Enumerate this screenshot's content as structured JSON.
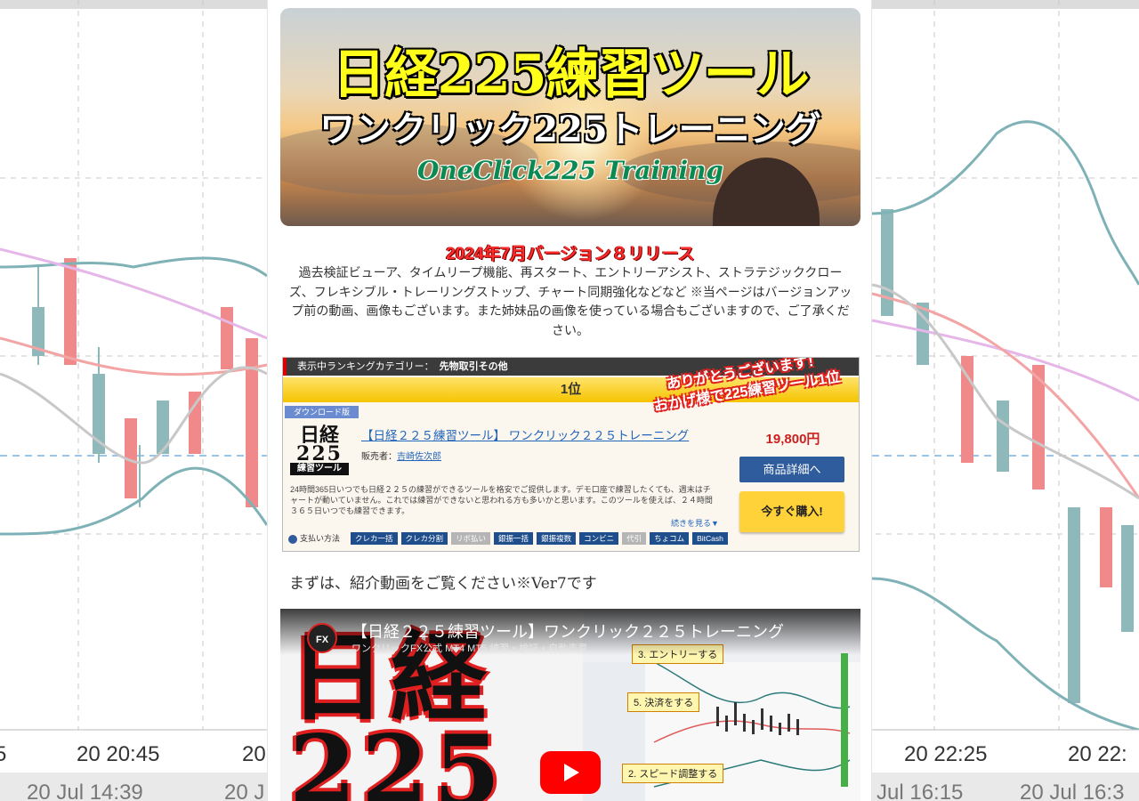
{
  "background": {
    "left_time_top": "20 20:45",
    "left_time_top_partial": "5",
    "left_time_top_partial_right": "20",
    "left_time_bottom": "20 Jul 14:39",
    "left_time_bottom_partial": "20 J",
    "right_time_top": "20 22:25",
    "right_time_top_2": "20 22:",
    "right_time_bottom": "Jul 16:15",
    "right_time_bottom_2": "20 Jul 16:3"
  },
  "hero": {
    "title": "日経225練習ツール",
    "subtitle": "ワンクリック225トレーニング",
    "english": "OneClick225 Training"
  },
  "release": {
    "title": "2024年7月バージョン８リリース",
    "text": "過去検証ビューア、タイムリープ機能、再スタート、エントリーアシスト、ストラテジッククローズ、フレキシブル・トレーリングストップ、チャート同期強化などなど ※当ページはバージョンアップ前の動画、画像もございます。また姉妹品の画像を使っている場合もございますので、ご了承ください。"
  },
  "ranking": {
    "category_label": "表示中ランキングカテゴリー：",
    "category_value": "先物取引その他",
    "rank": "1位",
    "thanks_line1": "ありがとうございます！",
    "thanks_line2": "おかげ様で225練習ツール1位",
    "download_badge": "ダウンロード版",
    "logo_line1": "日経",
    "logo_line2": "225",
    "logo_line3": "練習ツール",
    "product_title": "【日経２２５練習ツール】 ワンクリック２２５トレーニング",
    "seller_label": "販売者：",
    "seller_name": "吉崎佐次郎",
    "description": "24時間365日いつでも日経２２５の練習ができるツールを格安でご提供します。デモ口座で練習したくても、週末はチャートが動いていません。これでは練習ができないと思われる方も多いかと思います。このツールを使えば、２４時間３６５日いつでも練習できます。",
    "more_link": "続きを見る▼",
    "price": "19,800円",
    "detail_button": "商品詳細へ",
    "buy_button": "今すぐ購入!",
    "payment_label": "支払い方法",
    "payment_methods": [
      "クレカ一括",
      "クレカ分割",
      "リボ払い",
      "銀振一括",
      "銀振複数",
      "コンビニ",
      "代引",
      "ちょコム",
      "BitCash"
    ]
  },
  "intro_text": "まずは、紹介動画をご覧ください※Ver7です",
  "video": {
    "channel_icon": "FX",
    "title": "【日経２２５練習ツール】ワンクリック２２５トレーニング",
    "subtitle": "ワンクリックFX公式 MT4 MT5 練習・検証・自動売買",
    "thumb_big_text_1": "日経",
    "thumb_big_text_2": "225",
    "step_entry": "3. エントリーする",
    "step_close": "5. 決済をする",
    "step_speed": "2. スピード調整する"
  },
  "colors": {
    "release_red": "#ff2a2a",
    "title_yellow": "#ffff1a",
    "english_green": "#0a8a52",
    "detail_blue": "#2f5c9c",
    "buy_yellow": "#ffd23a",
    "price_red": "#cc2020",
    "youtube_red": "#ff0000"
  },
  "icons": [
    "play-icon",
    "payment-icon",
    "channel-icon"
  ]
}
